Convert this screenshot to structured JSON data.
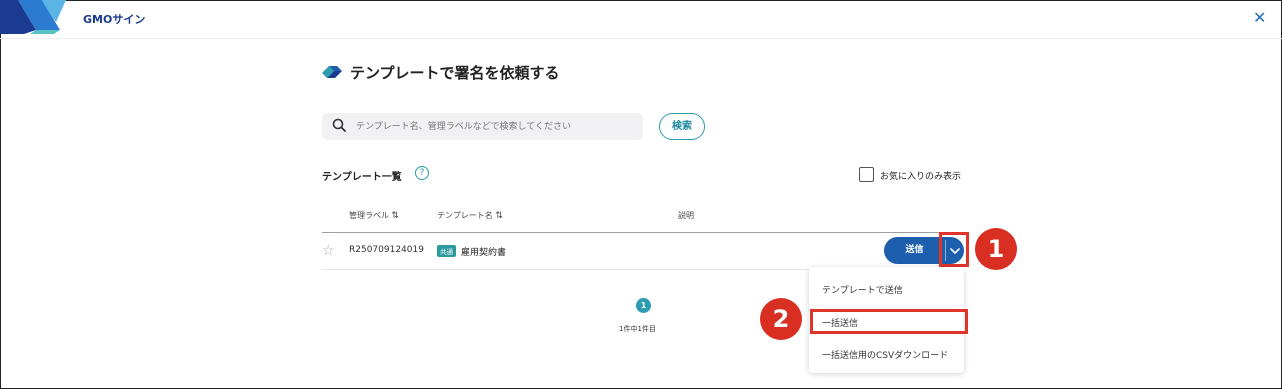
{
  "header": {
    "brand": "GMOサイン",
    "close_icon": "close-icon"
  },
  "page": {
    "title": "テンプレートで署名を依頼する"
  },
  "search": {
    "placeholder": "テンプレート名、管理ラベルなどで検索してください",
    "value": "",
    "button_label": "検索"
  },
  "list": {
    "heading": "テンプレート一覧",
    "favorites_only_label": "お気に入りのみ表示",
    "favorites_only_checked": false,
    "columns": {
      "management_label": "管理ラベル",
      "template_name": "テンプレート名",
      "description": "説明"
    },
    "rows": [
      {
        "management_label": "R250709124019",
        "badge": "共通",
        "template_name": "雇用契約書",
        "description": "",
        "send_label": "送信",
        "favorite": false
      }
    ]
  },
  "pagination": {
    "current_page": "1",
    "info": "1件中1件目"
  },
  "send_menu": {
    "items": [
      "テンプレートで送信",
      "一括送信",
      "一括送信用のCSVダウンロード"
    ]
  },
  "annotations": {
    "step1": "1",
    "step2": "2"
  },
  "colors": {
    "accent": "#2d9bb0",
    "primary_button": "#1d5fad",
    "annotation_red": "#d92e22",
    "brand_blue": "#1a3b8f"
  }
}
